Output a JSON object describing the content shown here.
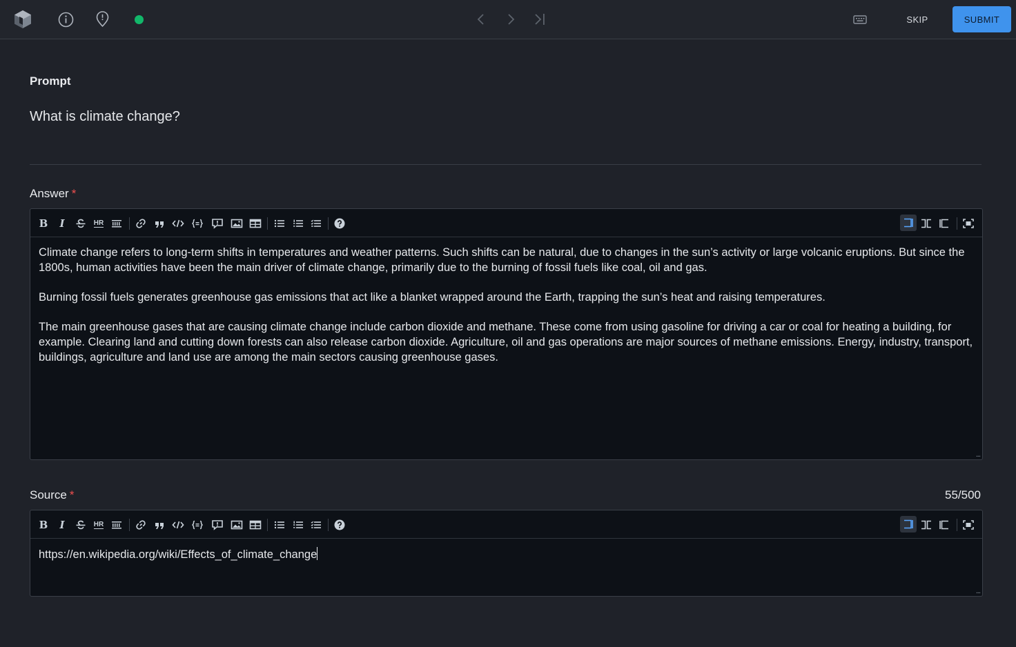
{
  "topbar": {
    "skip_label": "SKIP",
    "submit_label": "SUBMIT",
    "status_color": "#12b76a",
    "accent_color": "#3f93ed",
    "icons": [
      "app-logo-icon",
      "info-icon",
      "location-pin-icon",
      "chevron-left-icon",
      "chevron-right-icon",
      "skip-to-last-icon",
      "keyboard-icon"
    ]
  },
  "prompt": {
    "label": "Prompt",
    "text": "What is climate change?"
  },
  "answer": {
    "label": "Answer",
    "required_mark": "*",
    "paragraphs": [
      "Climate change refers to long-term shifts in temperatures and weather patterns. Such shifts can be natural, due to changes in the sun’s activity or large volcanic eruptions. But since the 1800s, human activities have been the main driver of climate change, primarily due to the burning of fossil fuels like coal, oil and gas.",
      "Burning fossil fuels generates greenhouse gas emissions that act like a blanket wrapped around the Earth, trapping the sun’s heat and raising temperatures.",
      "The main greenhouse gases that are causing climate change include carbon dioxide and methane. These come from using gasoline for driving a car or coal for heating a building, for example. Clearing land and cutting down forests can also release carbon dioxide. Agriculture, oil and gas operations are major sources of methane emissions. Energy, industry, transport, buildings, agriculture and land use are among the main sectors causing greenhouse gases."
    ]
  },
  "source": {
    "label": "Source",
    "required_mark": "*",
    "char_count": "55/500",
    "value": "https://en.wikipedia.org/wiki/Effects_of_climate_change"
  },
  "toolbar": {
    "bold": "B",
    "italic": "I",
    "hr": "HR",
    "buttons": [
      "bold",
      "italic",
      "strikethrough",
      "horizontal-rule",
      "line-break",
      "link",
      "quote",
      "code",
      "code-block",
      "comment",
      "image",
      "table",
      "bullet-list",
      "numbered-list",
      "task-list",
      "help"
    ],
    "view_modes": [
      "editor-only",
      "split",
      "preview-only",
      "fullscreen"
    ]
  },
  "resize_glyph": "..."
}
